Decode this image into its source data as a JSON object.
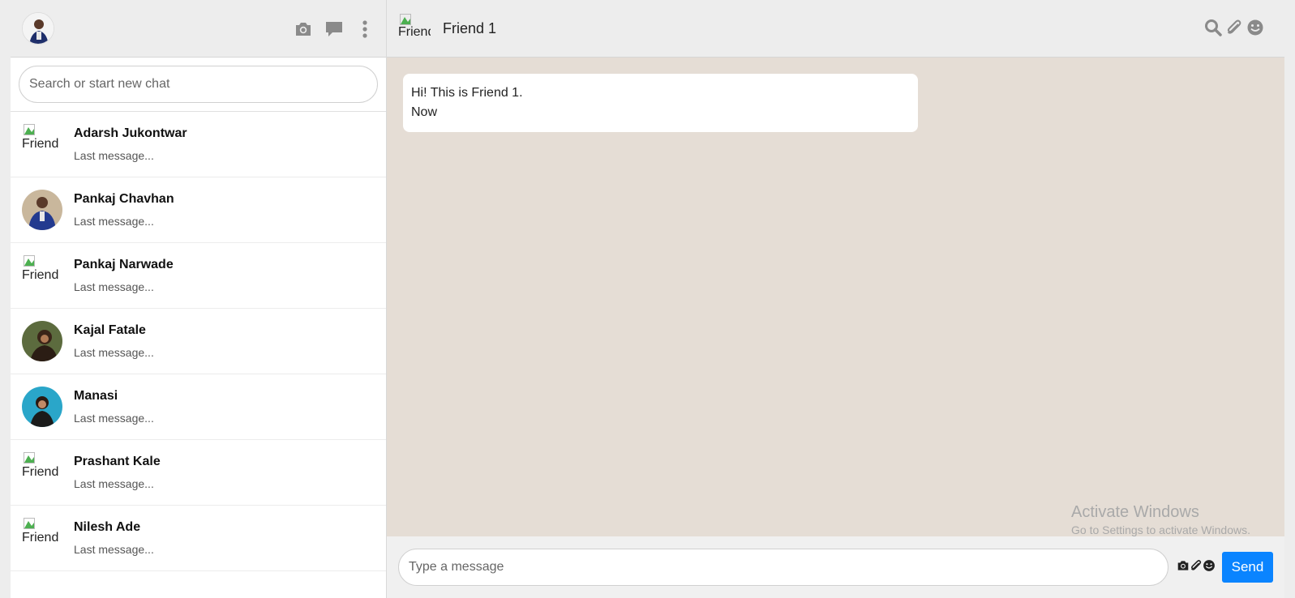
{
  "user": {
    "avatar_alt": "My profile"
  },
  "left_header": {
    "icons": [
      "camera-icon",
      "chat-icon",
      "menu-icon"
    ]
  },
  "search": {
    "placeholder": "Search or start new chat"
  },
  "chats": [
    {
      "name": "Adarsh Jukontwar",
      "last": "Last message...",
      "avatar": "broken",
      "alt": "Friend"
    },
    {
      "name": "Pankaj Chavhan",
      "last": "Last message...",
      "avatar": "photo",
      "photo_color": "#3c4d8a"
    },
    {
      "name": "Pankaj Narwade",
      "last": "Last message...",
      "avatar": "broken",
      "alt": "Friend"
    },
    {
      "name": "Kajal Fatale",
      "last": "Last message...",
      "avatar": "photo",
      "photo_color": "#6b7a4a"
    },
    {
      "name": "Manasi",
      "last": "Last message...",
      "avatar": "photo",
      "photo_color": "#2aa6c9"
    },
    {
      "name": "Prashant Kale",
      "last": "Last message...",
      "avatar": "broken",
      "alt": "Friend"
    },
    {
      "name": "Nilesh Ade",
      "last": "Last message...",
      "avatar": "broken",
      "alt": "Friend"
    }
  ],
  "conversation": {
    "friend_name": "Friend 1",
    "friend_avatar_alt": "Friend",
    "header_icons": [
      "search-icon",
      "paperclip-icon",
      "smiley-icon"
    ],
    "messages": [
      {
        "text": "Hi! This is Friend 1.",
        "time": "Now"
      }
    ]
  },
  "composer": {
    "placeholder": "Type a message",
    "icons": [
      "camera-icon",
      "paperclip-icon",
      "smiley-icon"
    ],
    "send_label": "Send"
  },
  "watermark": {
    "title": "Activate Windows",
    "subtitle": "Go to Settings to activate Windows."
  },
  "colors": {
    "header_bg": "#ededed",
    "chat_bg": "#e5ddd5",
    "send_button": "#0a84ff",
    "icon_gray": "#888888"
  }
}
